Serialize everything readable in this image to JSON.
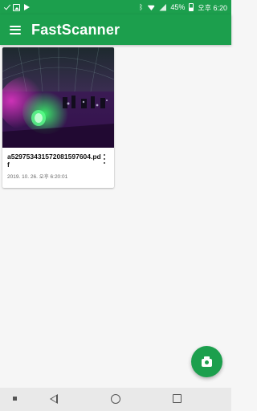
{
  "status_bar": {
    "battery": "45%",
    "time": "오후 6:20",
    "icons": [
      "check-icon",
      "image-icon",
      "play-store-icon",
      "bluetooth-icon",
      "wifi-icon",
      "signal-icon",
      "battery-icon"
    ]
  },
  "app_bar": {
    "title": "FastScanner",
    "menu_icon": "menu-icon"
  },
  "documents": [
    {
      "name": "a529753431572081597604.pdf",
      "date": "2019. 10. 26. 오후 6:20:01"
    }
  ],
  "fab": {
    "icon": "camera-icon"
  },
  "nav_bar": {
    "icons": [
      "dot-icon",
      "back-icon",
      "home-icon",
      "recents-icon"
    ]
  },
  "colors": {
    "primary": "#1c9f4d",
    "background": "#f6f6f6",
    "nav_background": "#e9e9e9"
  }
}
